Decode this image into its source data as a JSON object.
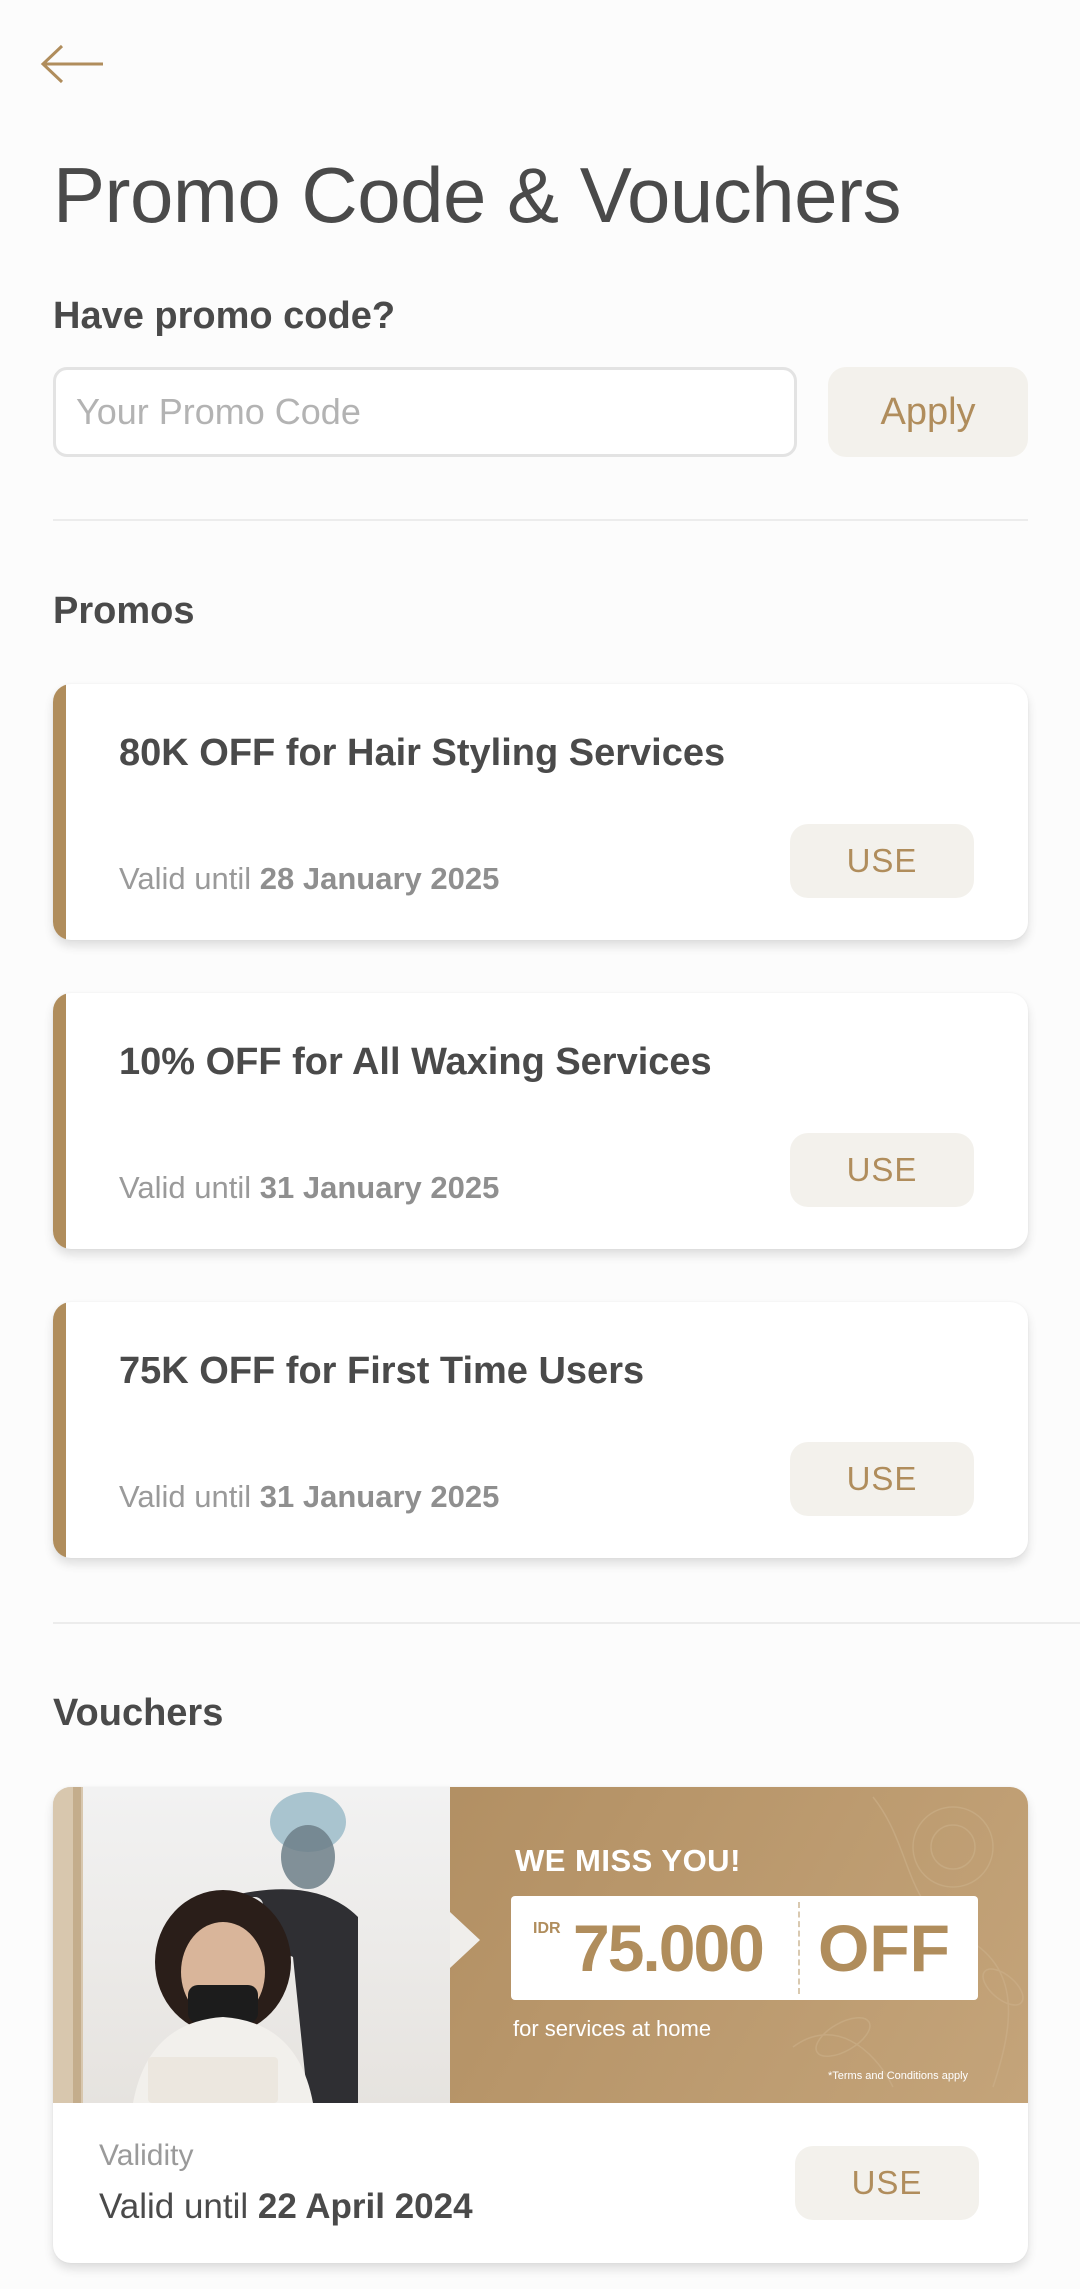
{
  "header": {
    "title": "Promo Code & Vouchers"
  },
  "promo_code": {
    "label": "Have promo code?",
    "input_value": "",
    "placeholder": "Your Promo Code",
    "apply_label": "Apply"
  },
  "promos": {
    "title": "Promos",
    "items": [
      {
        "title": "80K OFF for Hair Styling Services",
        "valid_prefix": "Valid until",
        "valid_date": "28 January 2025",
        "button": "USE"
      },
      {
        "title": "10% OFF for All Waxing Services",
        "valid_prefix": "Valid until",
        "valid_date": "31 January 2025",
        "button": "USE"
      },
      {
        "title": "75K OFF for First Time Users",
        "valid_prefix": "Valid until",
        "valid_date": "31 January 2025",
        "button": "USE"
      }
    ]
  },
  "vouchers": {
    "title": "Vouchers",
    "items": [
      {
        "banner_headline": "WE MISS YOU!",
        "banner_currency": "IDR",
        "banner_amount": "75.000",
        "banner_off": "OFF",
        "banner_subtitle": "for services at home",
        "banner_terms": "*Terms and Conditions apply",
        "validity_label": "Validity",
        "valid_prefix": "Valid until",
        "valid_date": "22 April 2024",
        "button": "USE"
      }
    ]
  },
  "colors": {
    "accent": "#b08d5c",
    "button_bg": "#f3f1ec",
    "text": "#4a4a4a"
  },
  "icons": {
    "back": "arrow-left-icon"
  }
}
